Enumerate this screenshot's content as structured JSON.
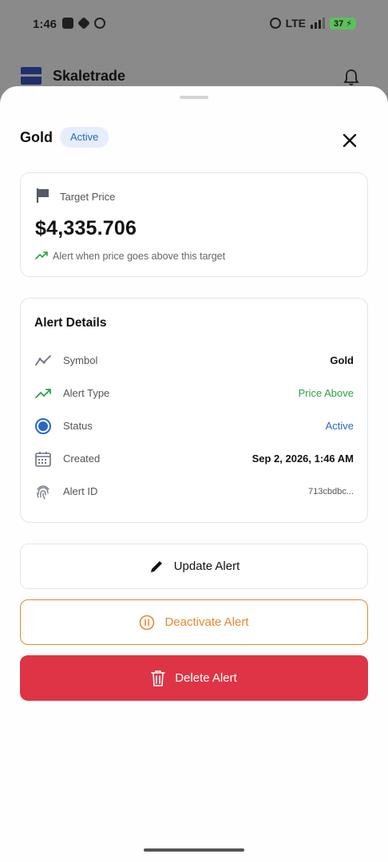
{
  "statusbar": {
    "time": "1:46",
    "network": "LTE",
    "battery": "37"
  },
  "app": {
    "name": "Skaletrade"
  },
  "sheet": {
    "title": "Gold",
    "status_badge": "Active",
    "target": {
      "label": "Target Price",
      "value": "$4,335.706",
      "hint": "Alert when price goes above this target"
    },
    "details": {
      "title": "Alert Details",
      "rows": [
        {
          "label": "Symbol",
          "value": "Gold",
          "icon": "chart-line-icon"
        },
        {
          "label": "Alert Type",
          "value": "Price Above",
          "icon": "trending-up-icon"
        },
        {
          "label": "Status",
          "value": "Active",
          "icon": "status-dot-icon"
        },
        {
          "label": "Created",
          "value": "Sep 2, 2026, 1:46 AM",
          "icon": "calendar-icon"
        },
        {
          "label": "Alert ID",
          "value": "713cbdbc...",
          "icon": "fingerprint-icon"
        }
      ]
    },
    "buttons": {
      "update": "Update Alert",
      "deactivate": "Deactivate Alert",
      "delete": "Delete Alert"
    }
  },
  "colors": {
    "green": "#2aa148",
    "blue": "#2a66c8",
    "orange": "#e8882f",
    "red": "#de3445",
    "brand": "#1e2f6b"
  }
}
